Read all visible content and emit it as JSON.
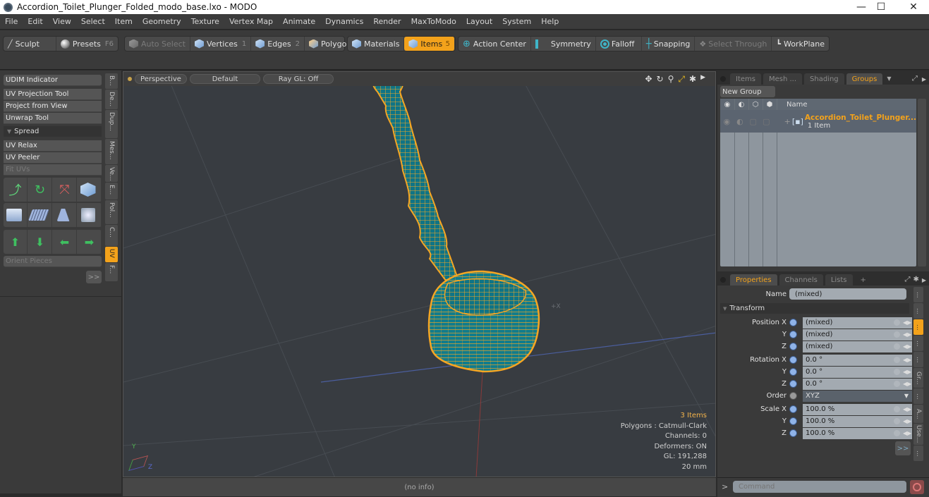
{
  "window": {
    "title": "Accordion_Toilet_Plunger_Folded_modo_base.lxo - MODO",
    "minimize_icon": "minimize-icon",
    "maximize_icon": "maximize-icon",
    "close_icon": "close-icon",
    "minimize": "—",
    "maximize": "☐",
    "close": "✕"
  },
  "menu": [
    "File",
    "Edit",
    "View",
    "Select",
    "Item",
    "Geometry",
    "Texture",
    "Vertex Map",
    "Animate",
    "Dynamics",
    "Render",
    "MaxToModo",
    "Layout",
    "System",
    "Help"
  ],
  "toolbar": {
    "sculpt": "Sculpt",
    "presets": "Presets",
    "presets_key": "F6",
    "auto_select": "Auto Select",
    "vertices": "Vertices",
    "vertices_key": "1",
    "edges": "Edges",
    "edges_key": "2",
    "polygons": "Polygons",
    "materials": "Materials",
    "items": "Items",
    "items_key": "5",
    "action_center": "Action Center",
    "symmetry": "Symmetry",
    "falloff": "Falloff",
    "snapping": "Snapping",
    "select_through": "Select Through",
    "workplane": "WorkPlane"
  },
  "left_panel": {
    "udim": "UDIM Indicator",
    "uv_projection": "UV Projection Tool",
    "project_from_view": "Project from View",
    "unwrap": "Unwrap Tool",
    "spread": "Spread",
    "uv_relax": "UV Relax",
    "uv_peeler": "UV Peeler",
    "fit_uvs": "Fit UVs",
    "orient_pieces": "Orient Pieces",
    "more": ">>",
    "vtabs": [
      "B...",
      "De...",
      "Dup...",
      "Mes...",
      "Ve...",
      "E...",
      "Pol...",
      "C...",
      "UV",
      "F..."
    ]
  },
  "viewport": {
    "view": "Perspective",
    "shading": "Default",
    "raygl": "Ray GL: Off",
    "info": {
      "items": "3 Items",
      "polygons": "Polygons : Catmull-Clark",
      "channels": "Channels: 0",
      "deformers": "Deformers: ON",
      "gl": "GL: 191,288",
      "scale": "20 mm"
    },
    "axis_x": "+X",
    "gizmo_y": "Y",
    "gizmo_z": "Z"
  },
  "status": "(no info)",
  "groups_panel": {
    "tabs": [
      "Items",
      "Mesh ...",
      "Shading",
      "Groups"
    ],
    "active_tab": "Groups",
    "new_group": "New Group",
    "col_name": "Name",
    "group_name": "Accordion_Toilet_Plunger...",
    "group_count": "1 Item"
  },
  "properties_panel": {
    "tabs": [
      "Properties",
      "Channels",
      "Lists",
      "+"
    ],
    "name_label": "Name",
    "name_value": "(mixed)",
    "transform": "Transform",
    "rows": [
      {
        "label": "Position X",
        "value": "(mixed)"
      },
      {
        "label": "Y",
        "value": "(mixed)"
      },
      {
        "label": "Z",
        "value": "(mixed)"
      },
      {
        "label": "Rotation X",
        "value": "0.0 °"
      },
      {
        "label": "Y",
        "value": "0.0 °"
      },
      {
        "label": "Z",
        "value": "0.0 °"
      },
      {
        "label": "Order",
        "value": "XYZ"
      },
      {
        "label": "Scale X",
        "value": "100.0 %"
      },
      {
        "label": "Y",
        "value": "100.0 %"
      },
      {
        "label": "Z",
        "value": "100.0 %"
      }
    ],
    "more": ">>",
    "vtabs": [
      "...",
      "...",
      "...",
      "...",
      "...",
      "Gr...",
      "...",
      "A...",
      "Use...",
      "..."
    ]
  },
  "command": {
    "prompt": ">",
    "placeholder": "Command"
  },
  "colors": {
    "accent": "#f3a21b",
    "mesh_fill": "#127a8a",
    "wire": "#f5a623"
  }
}
